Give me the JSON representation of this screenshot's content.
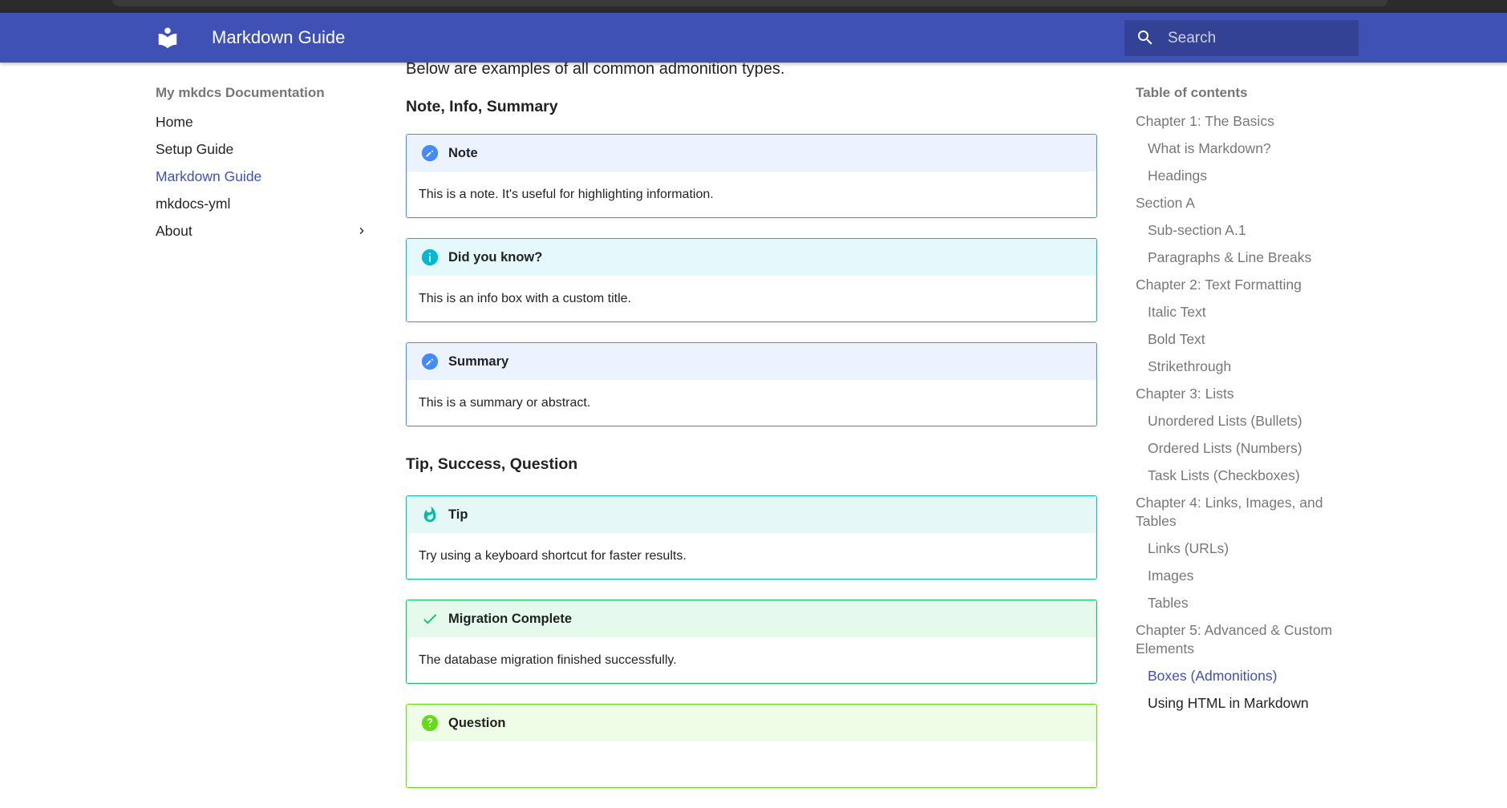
{
  "header": {
    "title": "Markdown Guide",
    "search_placeholder": "Search",
    "color": "#3f51b5"
  },
  "nav": {
    "heading": "My mkdcs Documentation",
    "items": [
      {
        "label": "Home"
      },
      {
        "label": "Setup Guide"
      },
      {
        "label": "Markdown Guide",
        "active": true
      },
      {
        "label": "mkdocs-yml"
      },
      {
        "label": "About",
        "expandable": true
      }
    ]
  },
  "content": {
    "intro": "Below are examples of all common admonition types.",
    "sections": [
      {
        "heading": "Note, Info, Summary"
      },
      {
        "heading": "Tip, Success, Question"
      }
    ],
    "admonitions": [
      {
        "title": "Note",
        "body": "This is a note. It's useful for highlighting information.",
        "icon": "pencil-icon",
        "border": "#448aff",
        "bg": "#ecf3ff",
        "icon_color": "#448aff"
      },
      {
        "title": "Did you know?",
        "body": "This is an info box with a custom title.",
        "icon": "info-icon",
        "border": "#00b8d4",
        "bg": "#e5f8fb",
        "icon_color": "#00b8d4"
      },
      {
        "title": "Summary",
        "body": "This is a summary or abstract.",
        "icon": "pencil-icon",
        "border": "#448aff",
        "bg": "#ecf3ff",
        "icon_color": "#448aff"
      },
      {
        "title": "Tip",
        "body": "Try using a keyboard shortcut for faster results.",
        "icon": "flame-icon",
        "border": "#00bfa5",
        "bg": "#e5f8f6",
        "icon_color": "#00bfa5"
      },
      {
        "title": "Migration Complete",
        "body": "The database migration finished successfully.",
        "icon": "check-icon",
        "border": "#00c853",
        "bg": "#e5f9ed",
        "icon_color": "#00c853"
      },
      {
        "title": "Question",
        "body": "",
        "icon": "question-icon",
        "border": "#64dd17",
        "bg": "#effce7",
        "icon_color": "#64dd17"
      }
    ]
  },
  "toc": {
    "heading": "Table of contents",
    "items": [
      {
        "label": "Chapter 1: The Basics",
        "level": 1
      },
      {
        "label": "What is Markdown?",
        "level": 2
      },
      {
        "label": "Headings",
        "level": 2
      },
      {
        "label": "Section A",
        "level": 1
      },
      {
        "label": "Sub-section A.1",
        "level": 2
      },
      {
        "label": "Paragraphs & Line Breaks",
        "level": 2
      },
      {
        "label": "Chapter 2: Text Formatting",
        "level": 1
      },
      {
        "label": "Italic Text",
        "level": 2
      },
      {
        "label": "Bold Text",
        "level": 2
      },
      {
        "label": "Strikethrough",
        "level": 2
      },
      {
        "label": "Chapter 3: Lists",
        "level": 1
      },
      {
        "label": "Unordered Lists (Bullets)",
        "level": 2
      },
      {
        "label": "Ordered Lists (Numbers)",
        "level": 2
      },
      {
        "label": "Task Lists (Checkboxes)",
        "level": 2
      },
      {
        "label": "Chapter 4: Links, Images, and Tables",
        "level": 1
      },
      {
        "label": "Links (URLs)",
        "level": 2
      },
      {
        "label": "Images",
        "level": 2
      },
      {
        "label": "Tables",
        "level": 2
      },
      {
        "label": "Chapter 5: Advanced & Custom Elements",
        "level": 1
      },
      {
        "label": "Boxes (Admonitions)",
        "level": 2,
        "active": true
      },
      {
        "label": "Using HTML in Markdown",
        "level": 2,
        "dark": true
      }
    ]
  }
}
